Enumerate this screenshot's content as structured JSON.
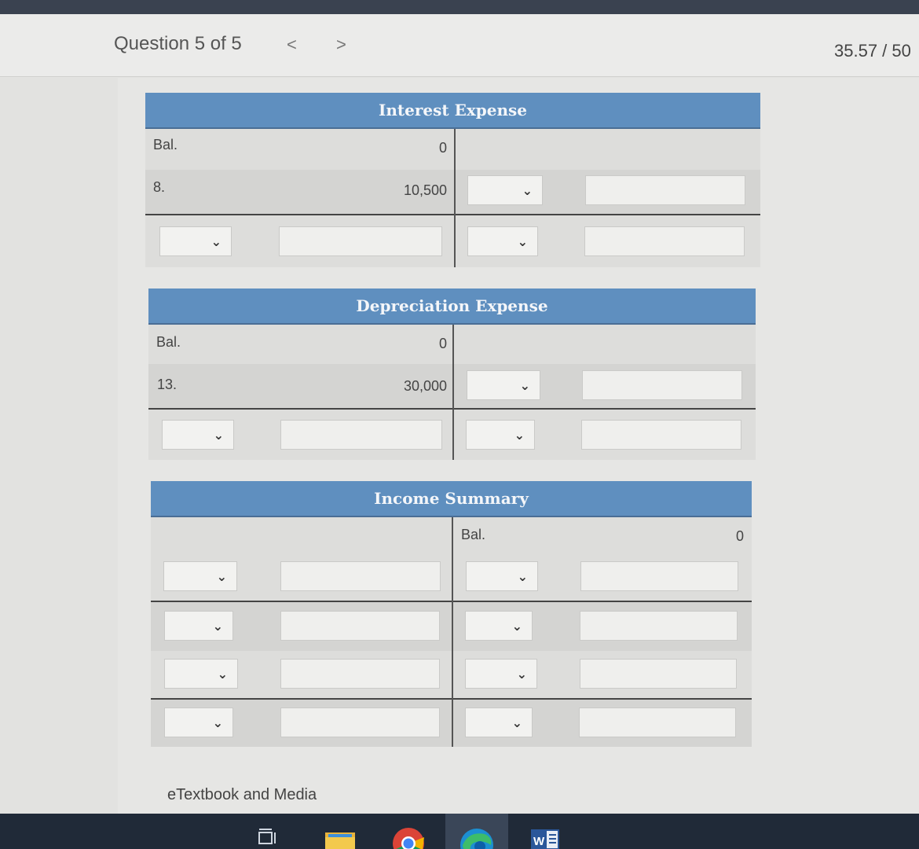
{
  "header": {
    "question_label": "Question 5 of 5",
    "prev_arrow": "<",
    "next_arrow": ">",
    "score": "35.57 / 50"
  },
  "accounts": {
    "interest": {
      "title": "Interest Expense",
      "rows": [
        {
          "label": "Bal.",
          "amount": "0"
        },
        {
          "label": "8.",
          "amount": "10,500"
        }
      ]
    },
    "depreciation": {
      "title": "Depreciation Expense",
      "rows": [
        {
          "label": "Bal.",
          "amount": "0"
        },
        {
          "label": "13.",
          "amount": "30,000"
        }
      ]
    },
    "income_summary": {
      "title": "Income Summary",
      "credit_label": "Bal.",
      "credit_amount": "0"
    }
  },
  "footer": {
    "etextbook_link": "eTextbook and Media"
  },
  "taskbar": {
    "icons": [
      "task-view-icon",
      "file-explorer-icon",
      "chrome-icon",
      "edge-icon",
      "word-icon"
    ],
    "word_letter": "W"
  },
  "colors": {
    "header_blue": "#5f8fbf",
    "taskbar": "#202a38"
  }
}
